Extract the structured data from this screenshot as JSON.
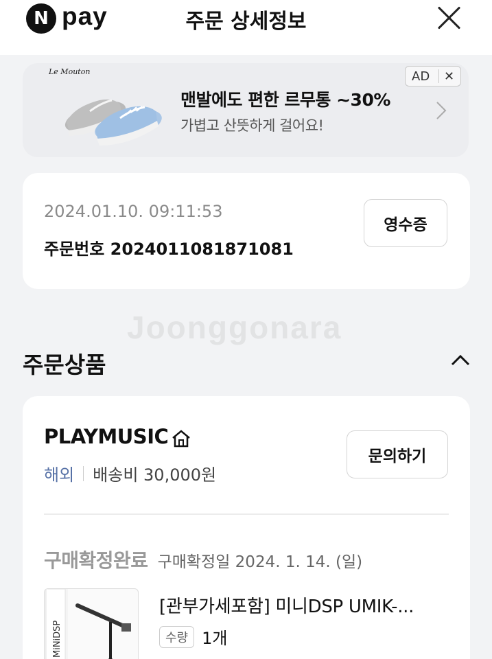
{
  "header": {
    "logo_n": "N",
    "logo_pay": "pay",
    "title": "주문 상세정보"
  },
  "ad": {
    "brand": "Le Mouton",
    "title": "맨발에도 편한 르무통 ~30%",
    "subtitle": "가볍고 산뜻하게 걸어요!",
    "badge": "AD",
    "badge_close": "✕"
  },
  "order": {
    "datetime": "2024.01.10. 09:11:53",
    "order_number": "주문번호 2024011081871081",
    "receipt_label": "영수증"
  },
  "watermark": "Joonggonara",
  "section": {
    "title": "주문상품"
  },
  "product_card": {
    "seller": "PLAYMUSIC",
    "overseas": "해외",
    "shipping": "배송비 30,000원",
    "inquiry_label": "문의하기",
    "status": "구매확정완료",
    "confirm_date": "구매확정일 2024. 1. 14. (일)",
    "product_name": "[관부가세포함] 미니DSP UMIK-...",
    "qty_label": "수량",
    "qty_value": "1개"
  },
  "colors": {
    "background": "#f2f3f5",
    "overseas_link": "#5671a6",
    "status_gray": "#999999"
  }
}
